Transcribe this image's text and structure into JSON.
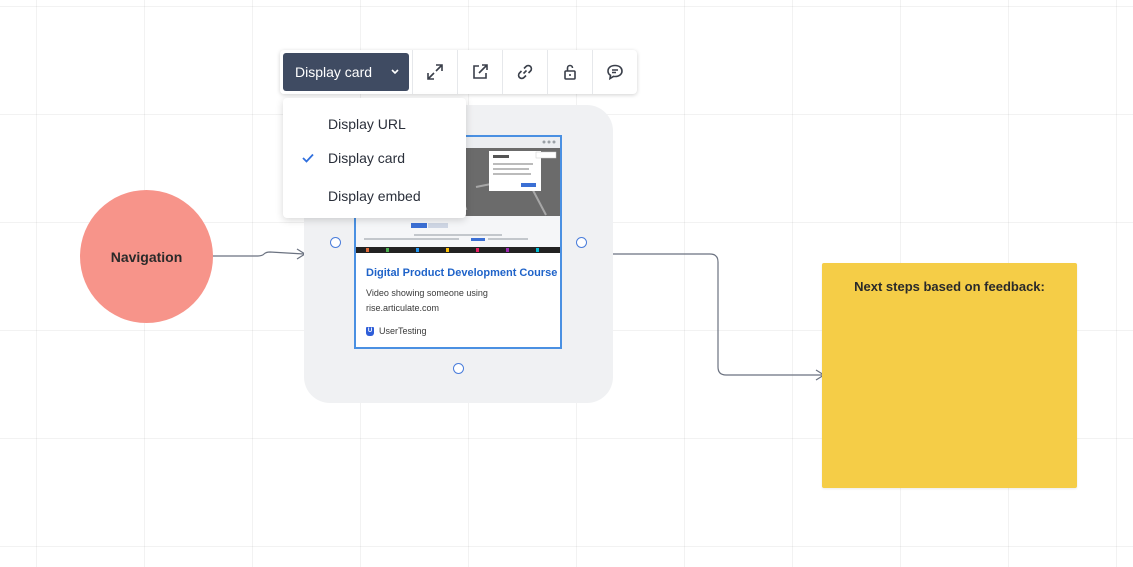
{
  "canvas": {
    "navigation_node": {
      "label": "Navigation",
      "color": "#f7948a"
    },
    "sticky_note": {
      "text": "Next steps based on feedback:",
      "color": "#f5cd47"
    }
  },
  "link_card": {
    "title": "Digital Product Development Course",
    "description": "Video showing someone using rise.articulate.com",
    "source": "UserTesting",
    "source_icon": "usertesting-logo-icon"
  },
  "toolbar": {
    "display_mode_label": "Display card",
    "buttons": [
      {
        "name": "expand",
        "icon": "expand-icon"
      },
      {
        "name": "open-link",
        "icon": "external-link-icon"
      },
      {
        "name": "copy-link",
        "icon": "link-icon"
      },
      {
        "name": "lock",
        "icon": "unlock-icon"
      },
      {
        "name": "comment",
        "icon": "comment-icon"
      }
    ]
  },
  "display_menu": {
    "items": [
      {
        "label": "Display URL",
        "selected": false
      },
      {
        "label": "Display card",
        "selected": true
      },
      {
        "label": "Display embed",
        "selected": false
      }
    ]
  },
  "colors": {
    "toolbar_primary": "#3f4b62",
    "accent_blue": "#4a90e2",
    "card_title": "#1f63c9",
    "frame_bg": "#f0f1f3"
  }
}
